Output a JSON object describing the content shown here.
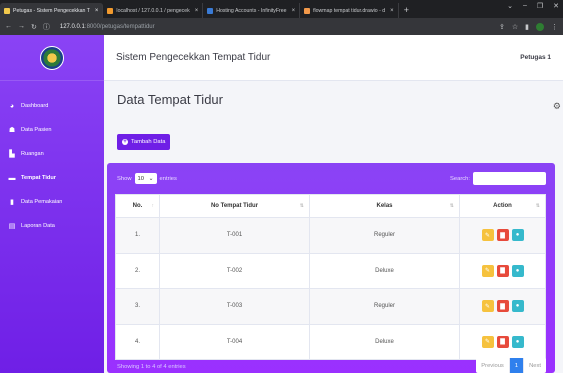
{
  "browser": {
    "tabs": [
      {
        "title": "Petugas - Sistem Pengecekkan T",
        "favicon": "#f2c94c",
        "active": true
      },
      {
        "title": "localhost / 127.0.0.1 / pengecek",
        "favicon": "#f29a2e",
        "active": false
      },
      {
        "title": "Hosting Accounts - InfinityFree",
        "favicon": "#3a7bd5",
        "active": false
      },
      {
        "title": "flowmap tempat tidur.drawio - d",
        "favicon": "#f2994a",
        "active": false
      }
    ],
    "tab_close": "×",
    "url_host": "127.0.0.1",
    "url_rest": ":8000/petugas/tempattidur"
  },
  "sidebar": {
    "items": [
      {
        "label": "Dashboard",
        "icon": "gauge-icon"
      },
      {
        "label": "Data Pasien",
        "icon": "users-icon"
      },
      {
        "label": "Ruangan",
        "icon": "building-icon"
      },
      {
        "label": "Tempat Tidur",
        "icon": "bed-icon",
        "active": true
      },
      {
        "label": "Data Pemakaian",
        "icon": "file-icon"
      },
      {
        "label": "Laporan Data",
        "icon": "report-icon"
      }
    ]
  },
  "header": {
    "app_title": "Sistem Pengecekkan Tempat Tidur",
    "user": "Petugas 1"
  },
  "page": {
    "title": "Data Tempat Tidur",
    "add_button": "Tambah Data"
  },
  "table_controls": {
    "show_label": "Show",
    "entries_value": "10",
    "entries_label": "entries",
    "search_label": "Search:"
  },
  "table": {
    "headers": [
      "No.",
      "No Tempat Tidur",
      "Kelas",
      "Action"
    ],
    "rows": [
      {
        "no": "1.",
        "bed": "T-001",
        "kelas": "Reguler"
      },
      {
        "no": "2.",
        "bed": "T-002",
        "kelas": "Deluxe"
      },
      {
        "no": "3.",
        "bed": "T-003",
        "kelas": "Reguler"
      },
      {
        "no": "4.",
        "bed": "T-004",
        "kelas": "Deluxe"
      }
    ]
  },
  "footer": {
    "info": "Showing 1 to 4 of 4 entries",
    "previous": "Previous",
    "current_page": "1",
    "next": "Next"
  },
  "colors": {
    "sidebar": "#8a43f5",
    "edit": "#f6c23e",
    "delete": "#e74a3b",
    "view": "#36b9cc",
    "pager_active": "#2f80ed"
  }
}
